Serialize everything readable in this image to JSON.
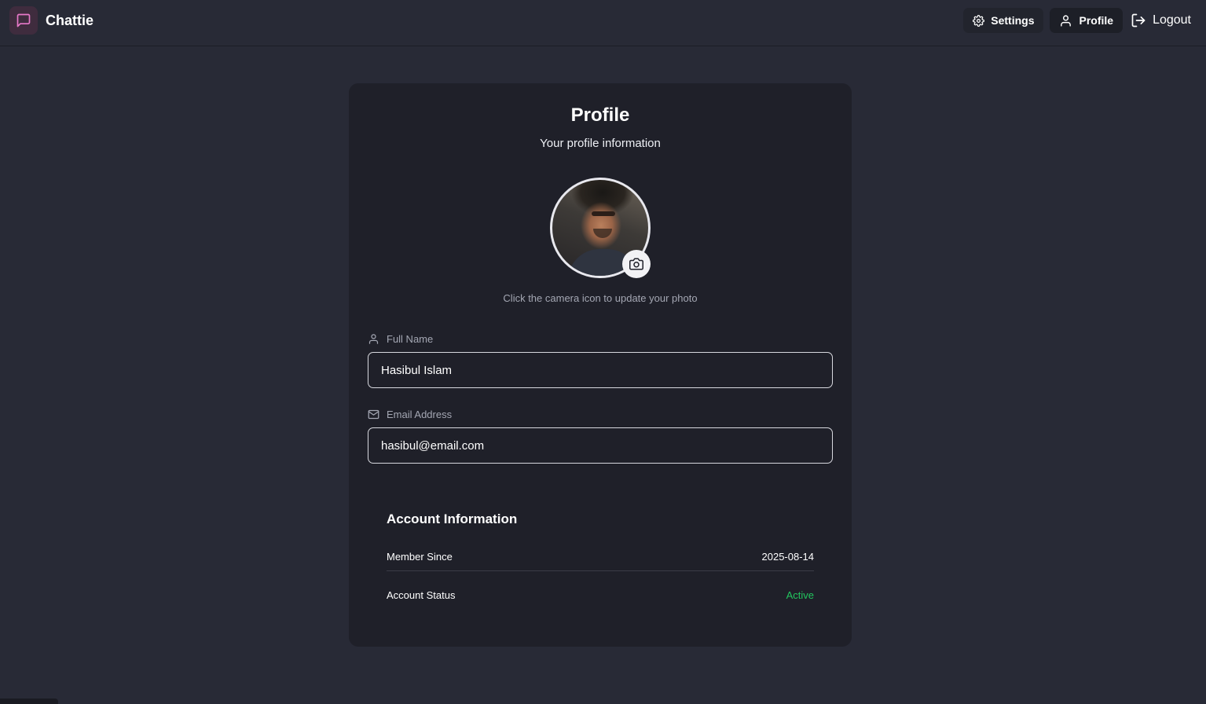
{
  "app": {
    "name": "Chattie",
    "logo_icon": "message-square-icon",
    "accent": "#e879c9"
  },
  "nav": {
    "settings_label": "Settings",
    "profile_label": "Profile",
    "logout_label": "Logout"
  },
  "profile": {
    "title": "Profile",
    "subtitle": "Your profile information",
    "photo_hint": "Click the camera icon to update your photo",
    "full_name_label": "Full Name",
    "full_name_value": "Hasibul Islam",
    "email_label": "Email Address",
    "email_value": "hasibul@email.com"
  },
  "account": {
    "title": "Account Information",
    "member_since_label": "Member Since",
    "member_since_value": "2025-08-14",
    "status_label": "Account Status",
    "status_value": "Active",
    "status_color": "#22c55e"
  }
}
